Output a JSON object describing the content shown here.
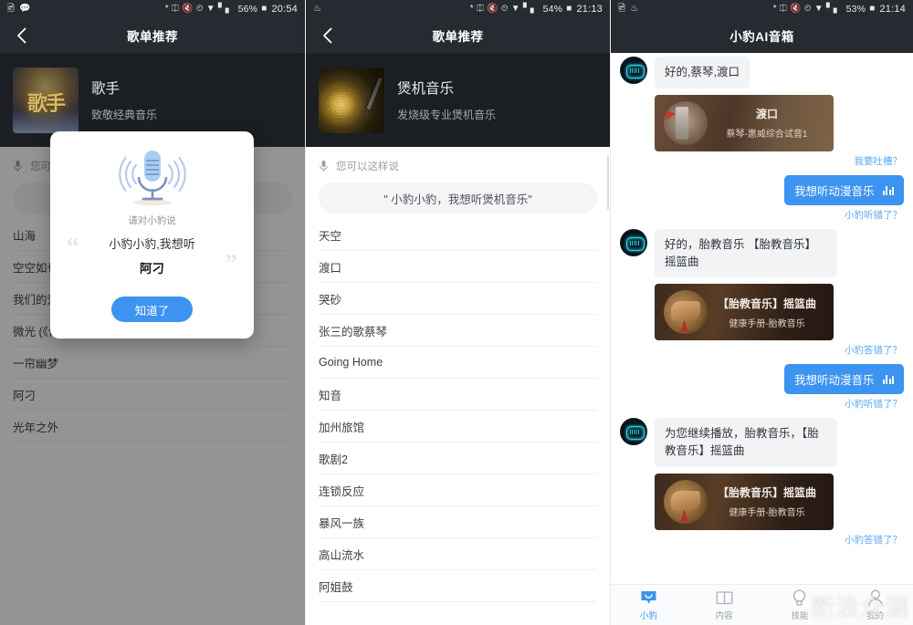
{
  "panels": [
    {
      "id": "playlist-singer",
      "statusbar": {
        "left_icons": [
          "image-icon",
          "message-icon"
        ],
        "icons": [
          "bluetooth-icon",
          "nfc-icon",
          "mute-icon",
          "alarm-icon",
          "wifi-icon",
          "signal-icon"
        ],
        "battery_percent": "56%",
        "time": "20:54"
      },
      "nav": {
        "back": "‹",
        "title": "歌单推荐"
      },
      "playlist": {
        "title": "歌手",
        "subtitle": "致敬经典音乐",
        "cover": "singer-album-art"
      },
      "say": {
        "label": "您可以这样说",
        "chip": ""
      },
      "songs": [
        "山海",
        "空空如也",
        "我们的爱",
        "微光 (《何以笙箫默》电视剧插曲)",
        "一帘幽梦",
        "阿刁",
        "光年之外"
      ],
      "modal": {
        "icon": "microphone-icon",
        "hint": "请对小豹说",
        "line1": "小豹小豹,我想听",
        "line2": "阿刁",
        "quote_left": "“",
        "quote_right": "”",
        "button": "知道了"
      }
    },
    {
      "id": "playlist-burnin",
      "statusbar": {
        "left_icons": [
          "flame-icon"
        ],
        "icons": [
          "bluetooth-icon",
          "nfc-icon",
          "mute-icon",
          "alarm-icon",
          "wifi-icon",
          "signal-icon"
        ],
        "battery_percent": "54%",
        "time": "21:13"
      },
      "nav": {
        "back": "‹",
        "title": "歌单推荐"
      },
      "playlist": {
        "title": "煲机音乐",
        "subtitle": "发烧级专业煲机音乐",
        "cover": "vinyl-record-art"
      },
      "say": {
        "label": "您可以这样说",
        "chip": "\" 小豹小豹，我想听煲机音乐\""
      },
      "songs": [
        "天空",
        "渡口",
        "哭砂",
        "张三的歌蔡琴",
        "Going Home",
        "知音",
        "加州旅馆",
        "歌剧2",
        "连锁反应",
        "暴风一族",
        "高山流水",
        "阿姐鼓"
      ]
    },
    {
      "id": "assistant-chat",
      "statusbar": {
        "left_icons": [
          "image-icon",
          "flame-icon"
        ],
        "icons": [
          "bluetooth-icon",
          "nfc-icon",
          "mute-icon",
          "alarm-icon",
          "wifi-icon",
          "signal-icon"
        ],
        "battery_percent": "53%",
        "time": "21:14"
      },
      "nav": {
        "back": "",
        "title": "小豹AI音箱"
      },
      "messages": [
        {
          "side": "in",
          "avatar": "bot-avatar-icon",
          "text": "好的,蔡琴,渡口",
          "card": {
            "style": "du",
            "thumb": "speaker-photo",
            "title": "渡口",
            "sub": "蔡琴-惠威综合试音1"
          },
          "feedback": "我要吐槽？"
        },
        {
          "side": "out",
          "text": "我想听动漫音乐",
          "equalizer": "audio-equalizer-icon",
          "feedback": "小豹听错了？"
        },
        {
          "side": "in",
          "avatar": "bot-avatar-icon",
          "text": "好的，胎教音乐 【胎教音乐】摇篮曲",
          "card": {
            "style": "lullaby",
            "thumb": "hands-photo",
            "title": "【胎教音乐】摇篮曲",
            "sub": "健康手册-胎教音乐"
          },
          "feedback": "小豹答错了？"
        },
        {
          "side": "out",
          "text": "我想听动漫音乐",
          "equalizer": "audio-equalizer-icon",
          "feedback": "小豹听错了？"
        },
        {
          "side": "in",
          "avatar": "bot-avatar-icon",
          "text": "为您继续播放，胎教音乐，【胎教音乐】摇篮曲",
          "card": {
            "style": "lullaby",
            "thumb": "hands-photo",
            "title": "【胎教音乐】摇篮曲",
            "sub": "健康手册-胎教音乐"
          },
          "feedback": "小豹答错了？"
        }
      ],
      "tabs": [
        {
          "label": "小豹",
          "icon": "smile-chat-icon",
          "active": true
        },
        {
          "label": "内容",
          "icon": "book-icon",
          "active": false
        },
        {
          "label": "技能",
          "icon": "bulb-icon",
          "active": false
        },
        {
          "label": "我的",
          "icon": "person-icon",
          "active": false
        }
      ],
      "watermark": "新浪众测"
    }
  ],
  "colors": {
    "accent_blue": "#3c93f0",
    "link_blue": "#5aa7f2",
    "statusbar_bg": "#262b31",
    "playlist_header_bg": "#1b1f24",
    "bubble_in_bg": "#f2f3f5"
  }
}
